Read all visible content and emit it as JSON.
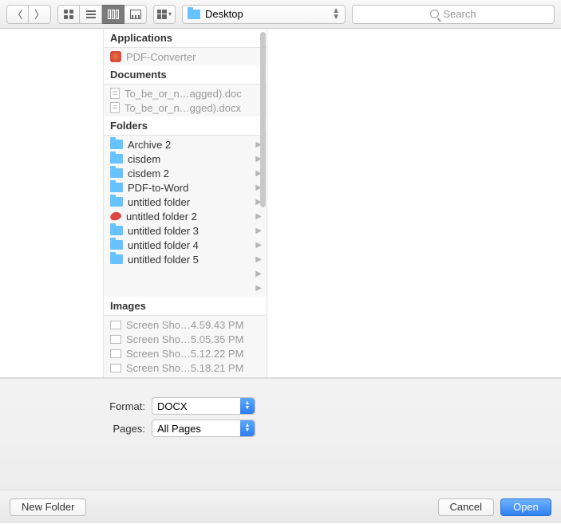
{
  "toolbar": {
    "location_label": "Desktop",
    "search_placeholder": "Search"
  },
  "groups": [
    {
      "header": "Applications",
      "items": [
        {
          "icon": "app",
          "label": "PDF-Converter",
          "dim": true,
          "arrow": false
        }
      ]
    },
    {
      "header": "Documents",
      "items": [
        {
          "icon": "doc",
          "label": "To_be_or_n…agged).doc",
          "dim": true,
          "arrow": false
        },
        {
          "icon": "doc",
          "label": "To_be_or_n…gged).docx",
          "dim": true,
          "arrow": false
        }
      ]
    },
    {
      "header": "Folders",
      "items": [
        {
          "icon": "folder",
          "label": "Archive 2",
          "dim": false,
          "arrow": true
        },
        {
          "icon": "folder",
          "label": "cisdem",
          "dim": false,
          "arrow": true
        },
        {
          "icon": "folder",
          "label": "cisdem 2",
          "dim": false,
          "arrow": true
        },
        {
          "icon": "folder",
          "label": "PDF-to-Word",
          "dim": false,
          "arrow": true
        },
        {
          "icon": "folder",
          "label": "untitled folder",
          "dim": false,
          "arrow": true
        },
        {
          "icon": "red",
          "label": "untitled folder 2",
          "dim": false,
          "arrow": true
        },
        {
          "icon": "folder",
          "label": "untitled folder 3",
          "dim": false,
          "arrow": true
        },
        {
          "icon": "folder",
          "label": "untitled folder 4",
          "dim": false,
          "arrow": true
        },
        {
          "icon": "folder",
          "label": "untitled folder 5",
          "dim": false,
          "arrow": true
        },
        {
          "icon": "none",
          "label": "",
          "dim": false,
          "arrow": true
        },
        {
          "icon": "none",
          "label": "",
          "dim": false,
          "arrow": true
        }
      ]
    },
    {
      "header": "Images",
      "items": [
        {
          "icon": "img",
          "label": "Screen Sho…4.59.43 PM",
          "dim": true,
          "arrow": false
        },
        {
          "icon": "img",
          "label": "Screen Sho…5.05.35 PM",
          "dim": true,
          "arrow": false
        },
        {
          "icon": "img",
          "label": "Screen Sho…5.12.22 PM",
          "dim": true,
          "arrow": false
        },
        {
          "icon": "img",
          "label": "Screen Sho…5.18.21 PM",
          "dim": true,
          "arrow": false
        }
      ]
    }
  ],
  "options": {
    "format_label": "Format:",
    "format_value": "DOCX",
    "pages_label": "Pages:",
    "pages_value": "All Pages"
  },
  "buttons": {
    "new_folder": "New Folder",
    "cancel": "Cancel",
    "open": "Open"
  }
}
